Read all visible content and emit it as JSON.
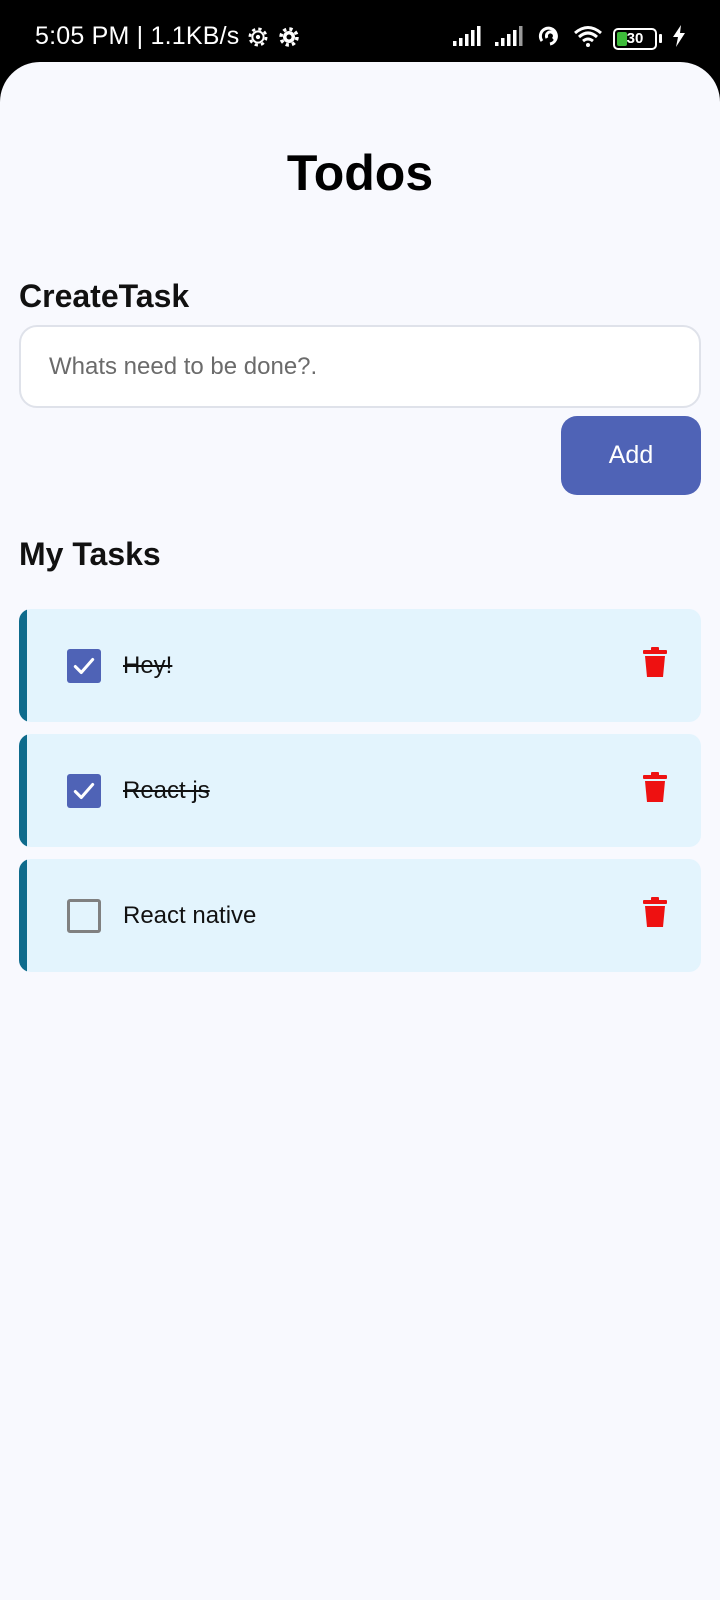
{
  "status_bar": {
    "time_speed": "5:05 PM | 1.1KB/s",
    "battery_level": "30",
    "battery_color": "#3dbb3a"
  },
  "app": {
    "title": "Todos",
    "create_heading": {
      "bold": "Create",
      "rest": "Task"
    },
    "input": {
      "placeholder": "Whats need to be done?.",
      "value": ""
    },
    "add_label": "Add",
    "my_heading": {
      "bold": "My",
      "rest": " Tasks"
    },
    "colors": {
      "background": "#f8f9fe",
      "accent_button": "#4f63b6",
      "task_background": "#e3f4fd",
      "task_accent": "#0e6b8c",
      "checkbox_checked": "#4f63b6",
      "delete_icon": "#ee1111"
    },
    "tasks": [
      {
        "label": "Hey!",
        "completed": true
      },
      {
        "label": "React js",
        "completed": true
      },
      {
        "label": "React native",
        "completed": false
      }
    ]
  }
}
